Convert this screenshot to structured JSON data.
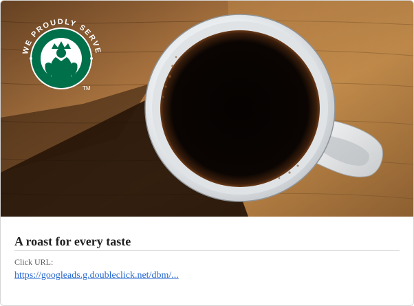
{
  "ad": {
    "image": {
      "subject": "coffee-mug-on-wooden-table",
      "logo": {
        "arc_text": "WE PROUDLY SERVE",
        "trademark": "TM",
        "brand_color": "#00704a"
      }
    },
    "headline": "A roast for every taste",
    "click_url_label": "Click URL:",
    "click_url": "https://googleads.g.doubleclick.net/dbm/..."
  },
  "colors": {
    "link": "#2a6ad0",
    "headline": "#202020",
    "label": "#5f5f5f",
    "logo_green": "#00704a"
  }
}
